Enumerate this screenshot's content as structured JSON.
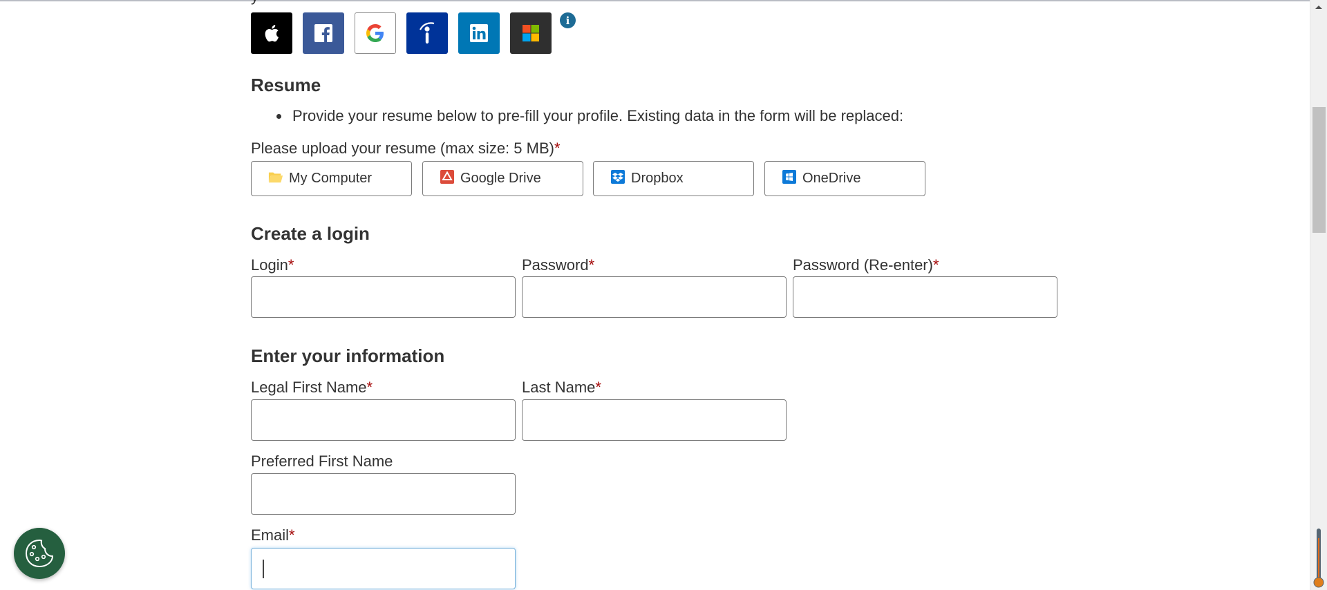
{
  "top_clipped_text": "y",
  "social_signin": {
    "buttons": [
      {
        "name": "apple",
        "icon": "apple-icon",
        "bg": "#000000"
      },
      {
        "name": "facebook",
        "icon": "facebook-icon",
        "bg": "#3b5998"
      },
      {
        "name": "google",
        "icon": "google-icon",
        "bg": "#ffffff"
      },
      {
        "name": "indeed",
        "icon": "indeed-icon",
        "bg": "#003399"
      },
      {
        "name": "linkedin",
        "icon": "linkedin-icon",
        "bg": "#0077b5"
      },
      {
        "name": "microsoft",
        "icon": "microsoft-icon",
        "bg": "#2f2f2f"
      }
    ],
    "info_glyph": "i"
  },
  "resume": {
    "title": "Resume",
    "bullet": "Provide your resume below to pre-fill your profile. Existing data in the form will be replaced:",
    "upload_label": "Please upload your resume (max size: 5 MB)",
    "required_mark": "*",
    "sources": [
      {
        "label": "My Computer",
        "icon": "folder-icon"
      },
      {
        "label": "Google Drive",
        "icon": "google-drive-icon"
      },
      {
        "label": "Dropbox",
        "icon": "dropbox-icon"
      },
      {
        "label": "OneDrive",
        "icon": "onedrive-icon"
      }
    ]
  },
  "login": {
    "title": "Create a login",
    "fields": [
      {
        "label": "Login",
        "required": "*",
        "value": ""
      },
      {
        "label": "Password",
        "required": "*",
        "value": ""
      },
      {
        "label": "Password (Re-enter)",
        "required": "*",
        "value": ""
      }
    ]
  },
  "info": {
    "title": "Enter your information",
    "legal_first_name": {
      "label": "Legal First Name",
      "required": "*",
      "value": ""
    },
    "last_name": {
      "label": "Last Name",
      "required": "*",
      "value": ""
    },
    "preferred_first_name": {
      "label": "Preferred First Name",
      "value": ""
    },
    "email": {
      "label": "Email",
      "required": "*",
      "value": ""
    }
  },
  "colors": {
    "text": "#333333",
    "required": "#a50b0b",
    "cookie_button": "#255f3f",
    "info_icon": "#1d6b95",
    "focus_border": "#7ab3dc"
  }
}
